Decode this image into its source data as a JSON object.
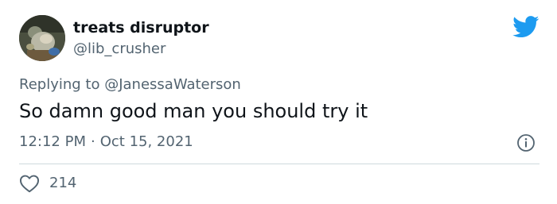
{
  "author": {
    "display_name": "treats disruptor",
    "handle": "@lib_crusher",
    "avatar_icon": "profile-avatar"
  },
  "brand": {
    "icon": "twitter-bird-icon",
    "color": "#1d9bf0"
  },
  "reply": {
    "prefix": "Replying to",
    "mention": "@JanessaWaterson"
  },
  "tweet": {
    "text": "So damn good man you should try it",
    "time": "12:12 PM",
    "separator": "·",
    "date": "Oct 15, 2021"
  },
  "actions": {
    "info_icon": "info-icon",
    "like_icon": "heart-icon",
    "like_count": "214"
  },
  "colors": {
    "primary_text": "#0f1419",
    "secondary_text": "#536471",
    "divider": "#cfd9de"
  }
}
